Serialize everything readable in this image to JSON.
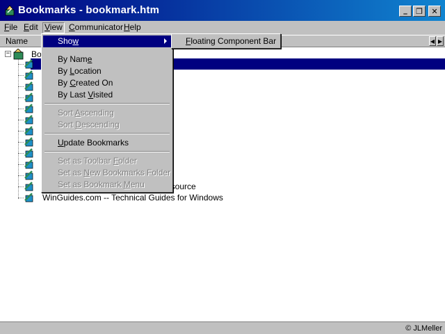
{
  "window": {
    "title": "Bookmarks - bookmark.htm",
    "min_label": "_",
    "restore_label": "❐",
    "close_label": "✕"
  },
  "menubar": [
    {
      "label": "File",
      "accel": "F",
      "rest": "ile"
    },
    {
      "label": "Edit",
      "accel": "E",
      "rest": "dit"
    },
    {
      "label": "View",
      "accel": "V",
      "rest": "iew"
    },
    {
      "label": "Communicator",
      "accel": "C",
      "rest": "ommunicator"
    },
    {
      "label": "Help",
      "accel": "H",
      "rest": "elp"
    }
  ],
  "columns": {
    "name": "Name"
  },
  "tree": {
    "root_label": "Bo",
    "visible_rows": [
      {
        "text": ""
      },
      {
        "text": "esource"
      },
      {
        "text": "WinGuides.com -- Technical Guides for Windows"
      }
    ]
  },
  "view_menu": {
    "show": {
      "label": "Show",
      "pre": "Sho",
      "accel": "w",
      "post": ""
    },
    "by_name": {
      "pre": "By Nam",
      "accel": "e",
      "post": ""
    },
    "by_location": {
      "pre": "By ",
      "accel": "L",
      "post": "ocation"
    },
    "by_created_on": {
      "pre": "By ",
      "accel": "C",
      "post": "reated On"
    },
    "by_last_visited": {
      "pre": "By Last ",
      "accel": "V",
      "post": "isited"
    },
    "sort_ascending": {
      "pre": "Sort ",
      "accel": "A",
      "post": "scending"
    },
    "sort_descending": {
      "pre": "Sort ",
      "accel": "D",
      "post": "escending"
    },
    "update_bookmarks": {
      "pre": "",
      "accel": "U",
      "post": "pdate Bookmarks"
    },
    "set_toolbar_folder": {
      "pre": "Set as Toolbar ",
      "accel": "F",
      "post": "older"
    },
    "set_new_bookmarks_folder": {
      "pre": "Set as ",
      "accel": "N",
      "post": "ew Bookmarks Folder"
    },
    "set_bookmark_menu": {
      "pre": "Set as Bookmark ",
      "accel": "M",
      "post": "enu"
    }
  },
  "show_submenu": {
    "pre": "",
    "accel": "F",
    "post": "loating Component Bar"
  },
  "status": {
    "text": "© JLMeller"
  },
  "colors": {
    "title_start": "#000080",
    "title_end": "#1084d0",
    "selection": "#000080",
    "face": "#c0c0c0"
  }
}
